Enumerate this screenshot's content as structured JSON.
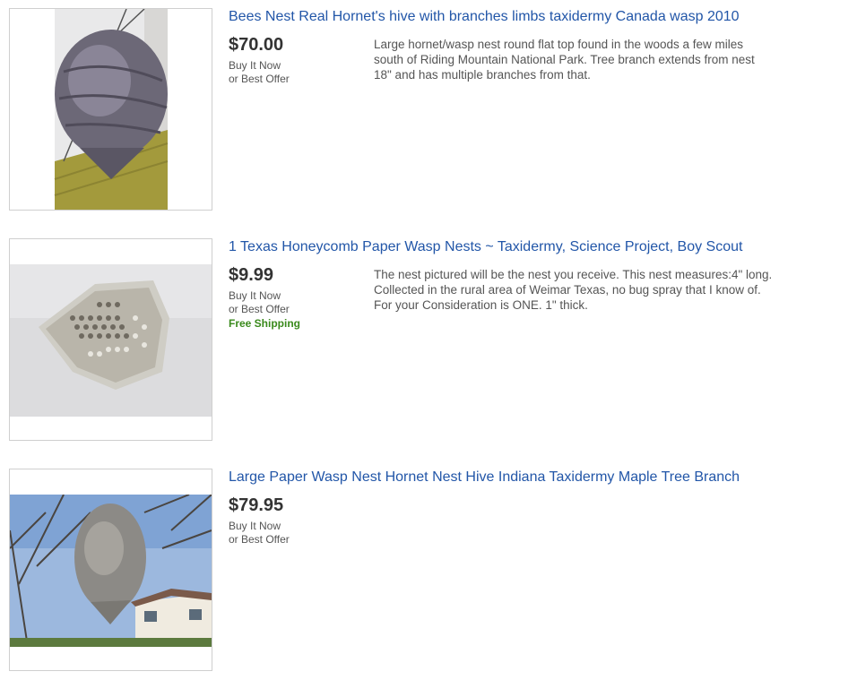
{
  "listings": [
    {
      "title": "Bees Nest Real Hornet's hive with branches limbs taxidermy Canada wasp 2010",
      "price": "$70.00",
      "format_line1": "Buy It Now",
      "format_line2": "or Best Offer",
      "shipping": "",
      "description": "Large hornet/wasp nest round flat top found in the woods a few miles south of Riding Mountain National Park. Tree branch extends from nest 18\" and has multiple branches from that."
    },
    {
      "title": "1 Texas Honeycomb Paper Wasp Nests ~ Taxidermy, Science Project, Boy Scout",
      "price": "$9.99",
      "format_line1": "Buy It Now",
      "format_line2": "or Best Offer",
      "shipping": "Free Shipping",
      "description": "The nest pictured will be the nest you receive. This nest measures:4\" long. Collected in the rural area of Weimar Texas, no bug spray that I know of. For your Consideration is ONE. 1\" thick."
    },
    {
      "title": "Large Paper Wasp Nest Hornet Nest Hive Indiana Taxidermy Maple Tree Branch",
      "price": "$79.95",
      "format_line1": "Buy It Now",
      "format_line2": "or Best Offer",
      "shipping": "",
      "description": ""
    }
  ],
  "colors": {
    "title_link": "#2256a8",
    "price": "#333333",
    "secondary_text": "#555555",
    "free_shipping": "#3a8a1c"
  }
}
